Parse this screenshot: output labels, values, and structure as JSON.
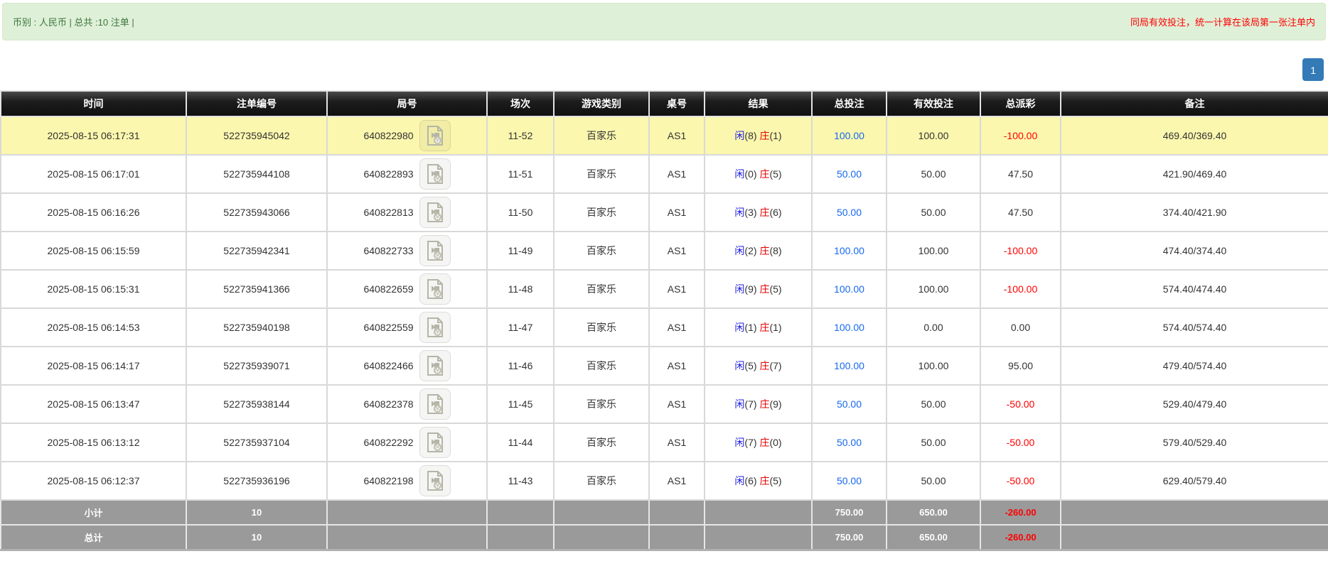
{
  "top_bar": {
    "summary": "币别 : 人民币 | 总共 :10 注单 |",
    "notice": "同局有效投注，统一计算在该局第一张注单内"
  },
  "pagination": {
    "current_page": "1"
  },
  "colors": {
    "green_bg": "#dff0d8",
    "green_border": "#d6e9c6",
    "green_text": "#3c763d",
    "notice_red": "#ff0000",
    "page_blue": "#337ab7",
    "grid": "#d9d9d9",
    "highlight_yellow": "#fbf7ae",
    "link_blue": "#1769f0",
    "player_blue": "#1d1de0",
    "banker_red": "#e60000",
    "neg_red": "#ff0000",
    "footer_gray": "#9a9a9a"
  },
  "icons": {
    "video_icon": "video-replay-document-icon"
  },
  "table": {
    "columns": [
      "时间",
      "注单编号",
      "局号",
      "场次",
      "游戏类别",
      "桌号",
      "结果",
      "总投注",
      "有效投注",
      "总派彩",
      "备注"
    ],
    "rows": [
      {
        "time": "2025-08-15 06:17:31",
        "bet_id": "522735945042",
        "round_no": "640822980",
        "session": "11-52",
        "game_type": "百家乐",
        "table_no": "AS1",
        "player_label": "闲",
        "player_score": "(8)",
        "banker_label": "庄",
        "banker_score": "(1)",
        "total_bet": "100.00",
        "valid_bet": "100.00",
        "payout": "-100.00",
        "remark": "469.40/369.40",
        "highlighted": true
      },
      {
        "time": "2025-08-15 06:17:01",
        "bet_id": "522735944108",
        "round_no": "640822893",
        "session": "11-51",
        "game_type": "百家乐",
        "table_no": "AS1",
        "player_label": "闲",
        "player_score": "(0)",
        "banker_label": "庄",
        "banker_score": "(5)",
        "total_bet": "50.00",
        "valid_bet": "50.00",
        "payout": "47.50",
        "remark": "421.90/469.40",
        "highlighted": false
      },
      {
        "time": "2025-08-15 06:16:26",
        "bet_id": "522735943066",
        "round_no": "640822813",
        "session": "11-50",
        "game_type": "百家乐",
        "table_no": "AS1",
        "player_label": "闲",
        "player_score": "(3)",
        "banker_label": "庄",
        "banker_score": "(6)",
        "total_bet": "50.00",
        "valid_bet": "50.00",
        "payout": "47.50",
        "remark": "374.40/421.90",
        "highlighted": false
      },
      {
        "time": "2025-08-15 06:15:59",
        "bet_id": "522735942341",
        "round_no": "640822733",
        "session": "11-49",
        "game_type": "百家乐",
        "table_no": "AS1",
        "player_label": "闲",
        "player_score": "(2)",
        "banker_label": "庄",
        "banker_score": "(8)",
        "total_bet": "100.00",
        "valid_bet": "100.00",
        "payout": "-100.00",
        "remark": "474.40/374.40",
        "highlighted": false
      },
      {
        "time": "2025-08-15 06:15:31",
        "bet_id": "522735941366",
        "round_no": "640822659",
        "session": "11-48",
        "game_type": "百家乐",
        "table_no": "AS1",
        "player_label": "闲",
        "player_score": "(9)",
        "banker_label": "庄",
        "banker_score": "(5)",
        "total_bet": "100.00",
        "valid_bet": "100.00",
        "payout": "-100.00",
        "remark": "574.40/474.40",
        "highlighted": false
      },
      {
        "time": "2025-08-15 06:14:53",
        "bet_id": "522735940198",
        "round_no": "640822559",
        "session": "11-47",
        "game_type": "百家乐",
        "table_no": "AS1",
        "player_label": "闲",
        "player_score": "(1)",
        "banker_label": "庄",
        "banker_score": "(1)",
        "total_bet": "100.00",
        "valid_bet": "0.00",
        "payout": "0.00",
        "remark": "574.40/574.40",
        "highlighted": false
      },
      {
        "time": "2025-08-15 06:14:17",
        "bet_id": "522735939071",
        "round_no": "640822466",
        "session": "11-46",
        "game_type": "百家乐",
        "table_no": "AS1",
        "player_label": "闲",
        "player_score": "(5)",
        "banker_label": "庄",
        "banker_score": "(7)",
        "total_bet": "100.00",
        "valid_bet": "100.00",
        "payout": "95.00",
        "remark": "479.40/574.40",
        "highlighted": false
      },
      {
        "time": "2025-08-15 06:13:47",
        "bet_id": "522735938144",
        "round_no": "640822378",
        "session": "11-45",
        "game_type": "百家乐",
        "table_no": "AS1",
        "player_label": "闲",
        "player_score": "(7)",
        "banker_label": "庄",
        "banker_score": "(9)",
        "total_bet": "50.00",
        "valid_bet": "50.00",
        "payout": "-50.00",
        "remark": "529.40/479.40",
        "highlighted": false
      },
      {
        "time": "2025-08-15 06:13:12",
        "bet_id": "522735937104",
        "round_no": "640822292",
        "session": "11-44",
        "game_type": "百家乐",
        "table_no": "AS1",
        "player_label": "闲",
        "player_score": "(7)",
        "banker_label": "庄",
        "banker_score": "(0)",
        "total_bet": "50.00",
        "valid_bet": "50.00",
        "payout": "-50.00",
        "remark": "579.40/529.40",
        "highlighted": false
      },
      {
        "time": "2025-08-15 06:12:37",
        "bet_id": "522735936196",
        "round_no": "640822198",
        "session": "11-43",
        "game_type": "百家乐",
        "table_no": "AS1",
        "player_label": "闲",
        "player_score": "(6)",
        "banker_label": "庄",
        "banker_score": "(5)",
        "total_bet": "50.00",
        "valid_bet": "50.00",
        "payout": "-50.00",
        "remark": "629.40/579.40",
        "highlighted": false
      }
    ],
    "footer": [
      {
        "label": "小计",
        "count": "10",
        "total_bet": "750.00",
        "valid_bet": "650.00",
        "payout": "-260.00"
      },
      {
        "label": "总计",
        "count": "10",
        "total_bet": "750.00",
        "valid_bet": "650.00",
        "payout": "-260.00"
      }
    ]
  }
}
